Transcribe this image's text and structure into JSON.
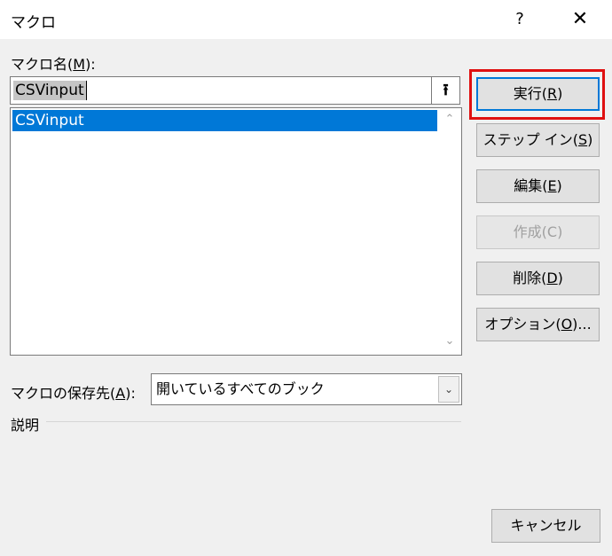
{
  "window": {
    "title": "マクロ",
    "help_label": "?",
    "close_label": "✕"
  },
  "macro_name": {
    "label_prefix": "マクロ名(",
    "label_key": "M",
    "label_suffix": "):",
    "value": "CSVinput",
    "upload_icon": "⭱"
  },
  "macro_list": {
    "items": [
      "CSVinput"
    ],
    "selected_index": 0,
    "scroll_up": "⌃",
    "scroll_down": "⌄"
  },
  "buttons": {
    "run": {
      "prefix": "実行(",
      "key": "R",
      "suffix": ")"
    },
    "step_in": {
      "prefix": "ステップ イン(",
      "key": "S",
      "suffix": ")"
    },
    "edit": {
      "prefix": "編集(",
      "key": "E",
      "suffix": ")"
    },
    "create": {
      "label": "作成(C)",
      "disabled": true
    },
    "delete": {
      "prefix": "削除(",
      "key": "D",
      "suffix": ")"
    },
    "options": {
      "prefix": "オプション(",
      "key": "O",
      "suffix": ")..."
    },
    "cancel": {
      "label": "キャンセル"
    }
  },
  "location": {
    "label_prefix": "マクロの保存先(",
    "label_key": "A",
    "label_suffix": "):",
    "value": "開いているすべてのブック",
    "dropdown_icon": "⌄"
  },
  "description": {
    "label": "説明"
  },
  "colors": {
    "selection": "#0078d7",
    "highlight_border": "#e01010",
    "dialog_bg": "#f0f0f0"
  }
}
